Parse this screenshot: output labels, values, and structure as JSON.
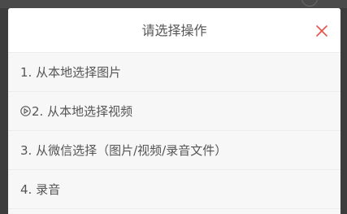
{
  "dialog": {
    "title": "请选择操作",
    "close_icon": "close-icon",
    "close_color": "#e8504a"
  },
  "options": [
    {
      "label": "1. 从本地选择图片"
    },
    {
      "icon": "play-circle-icon",
      "label": "2. 从本地选择视频"
    },
    {
      "label": "3. 从微信选择（图片/视频/录音文件）"
    },
    {
      "label": "4. 录音"
    }
  ]
}
